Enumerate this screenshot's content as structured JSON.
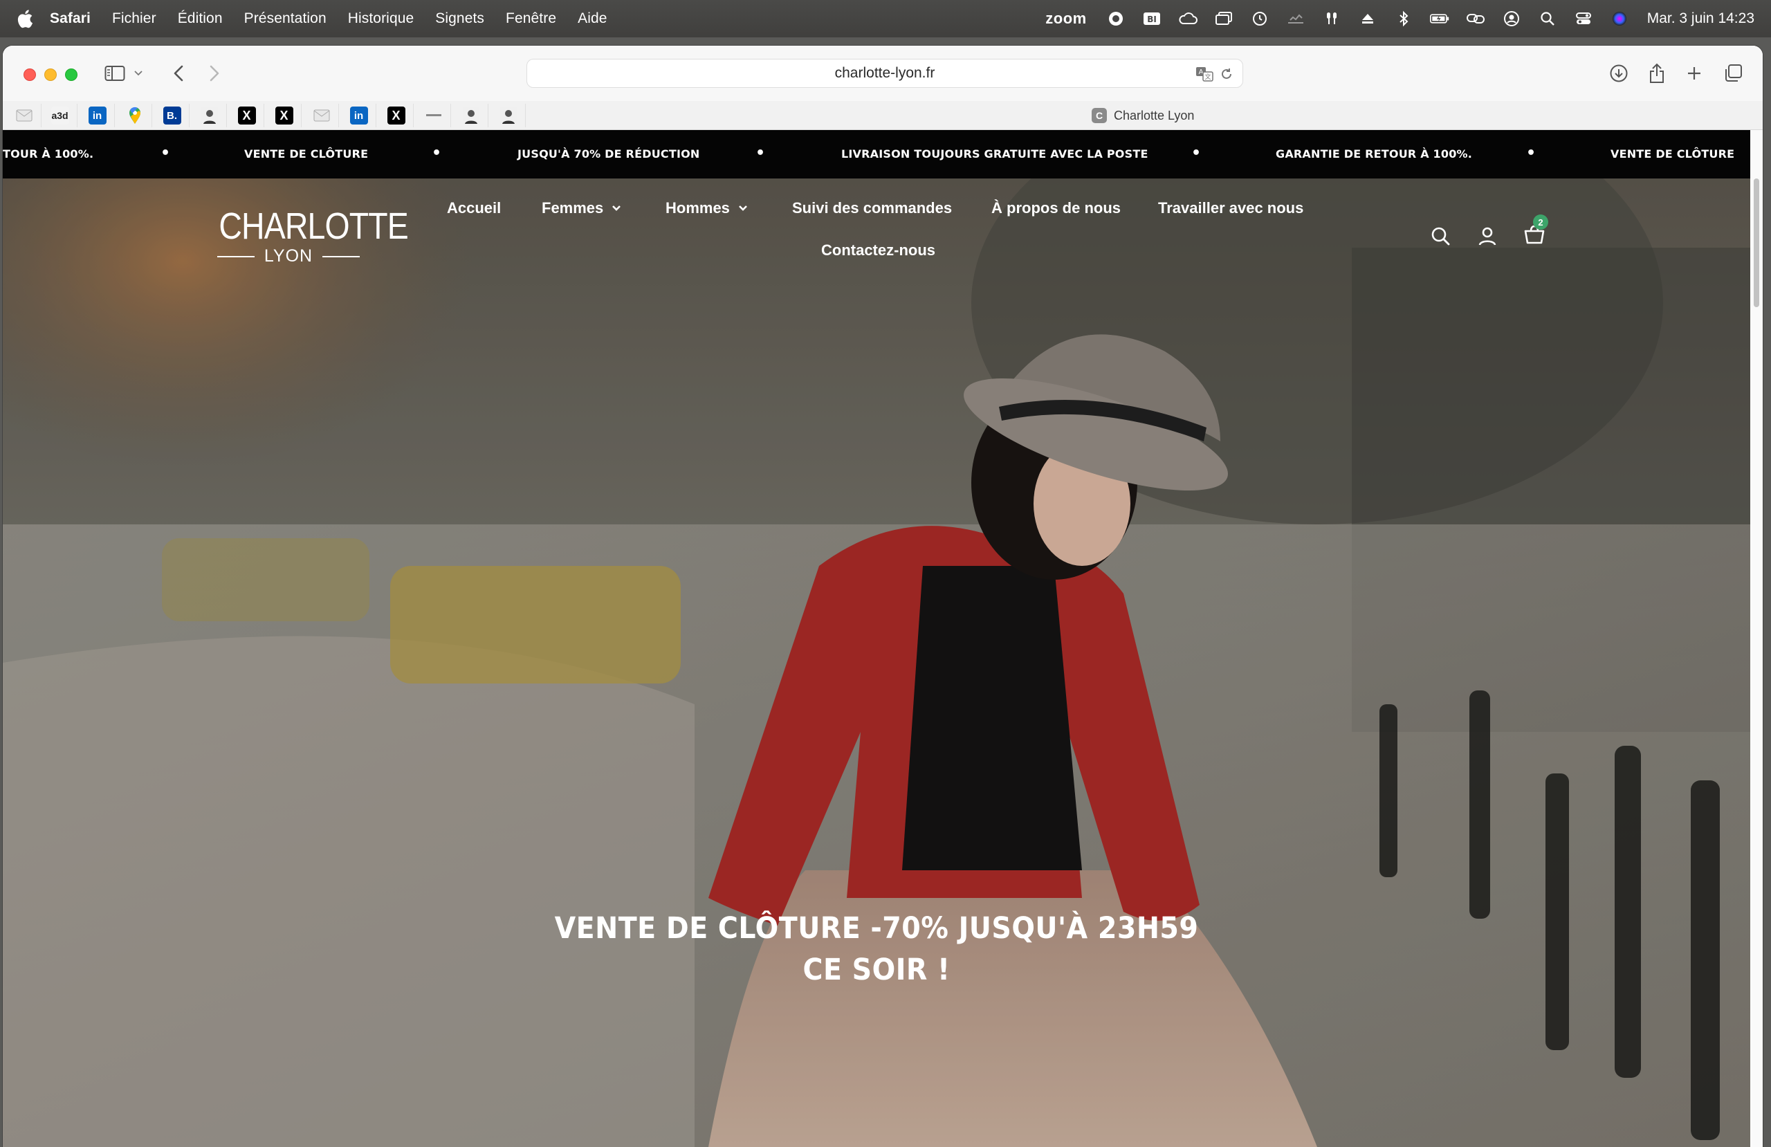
{
  "menubar": {
    "app_name": "Safari",
    "menus": [
      "Fichier",
      "Édition",
      "Présentation",
      "Historique",
      "Signets",
      "Fenêtre",
      "Aide"
    ],
    "status_zoom": "zoom",
    "clock": "Mar. 3 juin  14:23"
  },
  "browser": {
    "url": "charlotte-lyon.fr",
    "tab_title": "Charlotte Lyon",
    "tab_favicon_letter": "C",
    "favorites": [
      {
        "icon": "mail-icon",
        "text": ""
      },
      {
        "icon": "a3d-icon",
        "text": "a3d"
      },
      {
        "icon": "linkedin-icon",
        "text": "in"
      },
      {
        "icon": "maps-pin-icon",
        "text": ""
      },
      {
        "icon": "booking-icon",
        "text": "B."
      },
      {
        "icon": "person-icon",
        "text": ""
      },
      {
        "icon": "x-icon",
        "text": "X"
      },
      {
        "icon": "x-icon",
        "text": "X"
      },
      {
        "icon": "mail-icon",
        "text": ""
      },
      {
        "icon": "linkedin-icon",
        "text": "in"
      },
      {
        "icon": "x-icon",
        "text": "X"
      },
      {
        "icon": "dash-icon",
        "text": ""
      },
      {
        "icon": "person-icon",
        "text": ""
      },
      {
        "icon": "person-icon",
        "text": ""
      }
    ]
  },
  "announcement_bar": {
    "messages": [
      "TOUR À 100%.",
      "VENTE DE CLÔTURE",
      "JUSQU'À 70% DE RÉDUCTION",
      "LIVRAISON TOUJOURS GRATUITE AVEC LA POSTE",
      "GARANTIE DE RETOUR À 100%.",
      "VENTE DE CLÔTURE"
    ],
    "separator": "•"
  },
  "header": {
    "logo_word": "CHARLOTTE",
    "logo_sub": "LYON",
    "nav": [
      "Accueil",
      "Femmes",
      "Hommes",
      "Suivi des commandes",
      "À propos de nous",
      "Travailler avec nous",
      "Contactez-nous"
    ],
    "cart_count": "2"
  },
  "hero": {
    "headline_line1": "VENTE DE CLÔTURE -70% JUSQU'À 23H59",
    "headline_line2": "CE SOIR !"
  },
  "colors": {
    "traffic_red": "#ff5f57",
    "traffic_yellow": "#febc2e",
    "traffic_green": "#28c840",
    "cart_badge": "#3da46a",
    "announcement_bg": "#050505"
  }
}
